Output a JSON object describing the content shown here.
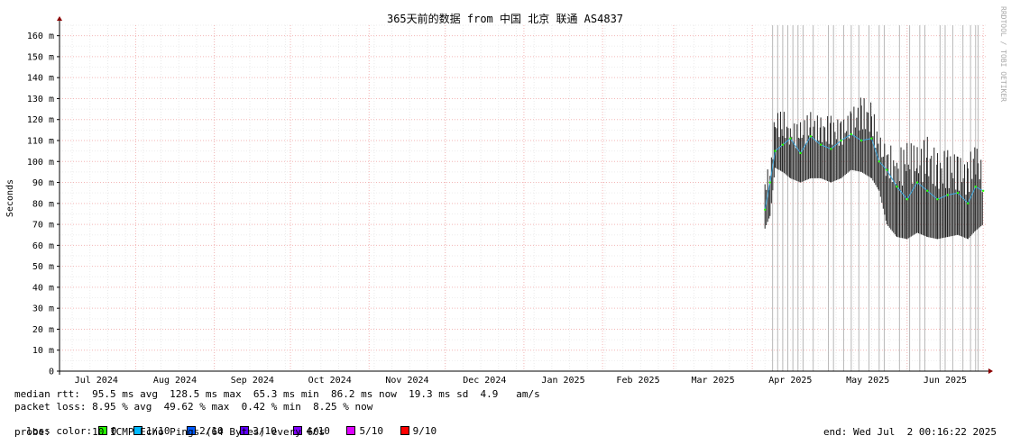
{
  "chart_data": {
    "type": "line",
    "title": "365天前的数据 from 中国 北京 联通 AS4837",
    "ylabel": "Seconds",
    "ylim": [
      0,
      165
    ],
    "yticks": [
      "0",
      "10 m",
      "20 m",
      "30 m",
      "40 m",
      "50 m",
      "60 m",
      "70 m",
      "80 m",
      "90 m",
      "100 m",
      "110 m",
      "120 m",
      "130 m",
      "140 m",
      "150 m",
      "160 m"
    ],
    "xticks": [
      "Jul 2024",
      "Aug 2024",
      "Sep 2024",
      "Oct 2024",
      "Nov 2024",
      "Dec 2024",
      "Jan 2025",
      "Feb 2025",
      "Mar 2025",
      "Apr 2025",
      "May 2025",
      "Jun 2025"
    ],
    "xrange": [
      "2024-07-02",
      "2025-07-02"
    ],
    "grid": true,
    "series": [
      {
        "x": [
          "2025-04-06",
          "2025-04-08",
          "2025-04-10",
          "2025-04-13",
          "2025-04-16",
          "2025-04-20",
          "2025-04-24",
          "2025-04-28",
          "2025-05-02",
          "2025-05-06",
          "2025-05-10",
          "2025-05-14",
          "2025-05-18",
          "2025-05-21",
          "2025-05-24",
          "2025-05-28",
          "2025-06-01",
          "2025-06-05",
          "2025-06-09",
          "2025-06-13",
          "2025-06-17",
          "2025-06-21",
          "2025-06-25",
          "2025-06-28",
          "2025-07-01"
        ],
        "y": [
          77,
          90,
          105,
          108,
          111,
          104,
          112,
          108,
          106,
          110,
          113,
          110,
          111,
          100,
          96,
          88,
          82,
          90,
          86,
          82,
          84,
          85,
          80,
          88,
          86
        ],
        "ymin": [
          68,
          74,
          97,
          95,
          92,
          90,
          92,
          92,
          90,
          92,
          96,
          95,
          92,
          86,
          70,
          64,
          63,
          66,
          64,
          63,
          64,
          65,
          63,
          67,
          70
        ],
        "ymax": [
          95,
          98,
          124,
          125,
          118,
          120,
          124,
          121,
          122,
          120,
          125,
          131,
          128,
          113,
          110,
          104,
          112,
          108,
          112,
          104,
          106,
          104,
          100,
          114,
          96
        ]
      }
    ],
    "loss_spikes": [
      "2025-04-09",
      "2025-04-11",
      "2025-04-13",
      "2025-04-15",
      "2025-04-17",
      "2025-04-19",
      "2025-04-21",
      "2025-04-25",
      "2025-05-01",
      "2025-05-03",
      "2025-05-07",
      "2025-05-10",
      "2025-05-13",
      "2025-05-17",
      "2025-05-21",
      "2025-05-23",
      "2025-05-29",
      "2025-06-02",
      "2025-06-06",
      "2025-06-08",
      "2025-06-14",
      "2025-06-16",
      "2025-06-19",
      "2025-06-23",
      "2025-06-26",
      "2025-06-28",
      "2025-06-29"
    ]
  },
  "watermark": "RRDTOOL / TOBI OETIKER",
  "stats": {
    "median_rtt": "median rtt:  95.5 ms avg  128.5 ms max  65.3 ms min  86.2 ms now  19.3 ms sd  4.9   am/s",
    "packet_loss": "packet loss: 8.95 % avg  49.62 % max  0.42 % min  8.25 % now",
    "loss_color_label": "loss color:",
    "probe": "probe:       10 ICMP Echo Pings (64 Bytes) every 60s",
    "end": "end: Wed Jul  2 00:16:22 2025"
  },
  "loss_colors": [
    {
      "label": "0",
      "color": "#26ff00"
    },
    {
      "label": "1/10",
      "color": "#00b8ff"
    },
    {
      "label": "2/10",
      "color": "#0059ff"
    },
    {
      "label": "3/10",
      "color": "#5e00ff"
    },
    {
      "label": "4/10",
      "color": "#7e00ff"
    },
    {
      "label": "5/10",
      "color": "#dd00ff"
    },
    {
      "label": "9/10",
      "color": "#ff0000"
    }
  ]
}
